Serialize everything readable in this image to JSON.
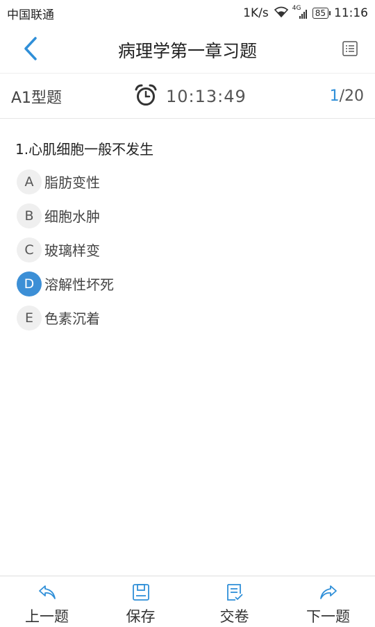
{
  "status_bar": {
    "carrier": "中国联通",
    "speed": "1K/s",
    "network": "4G",
    "battery": "85",
    "time": "11:16"
  },
  "header": {
    "title": "病理学第一章习题",
    "back_icon": "chevron-left-icon",
    "card_icon": "answer-card-icon"
  },
  "info": {
    "question_type": "A1型题",
    "timer": "10:13:49",
    "current": "1",
    "total": "/20"
  },
  "question": {
    "text": "1.心肌细胞一般不发生",
    "options": [
      {
        "letter": "A",
        "text": "脂肪变性",
        "selected": false
      },
      {
        "letter": "B",
        "text": "细胞水肿",
        "selected": false
      },
      {
        "letter": "C",
        "text": "玻璃样变",
        "selected": false
      },
      {
        "letter": "D",
        "text": "溶解性坏死",
        "selected": true
      },
      {
        "letter": "E",
        "text": "色素沉着",
        "selected": false
      }
    ]
  },
  "bottom_bar": {
    "prev": "上一题",
    "save": "保存",
    "submit": "交卷",
    "next": "下一题"
  },
  "colors": {
    "accent": "#3c8fd6",
    "icon_blue": "#2f8fd8"
  }
}
